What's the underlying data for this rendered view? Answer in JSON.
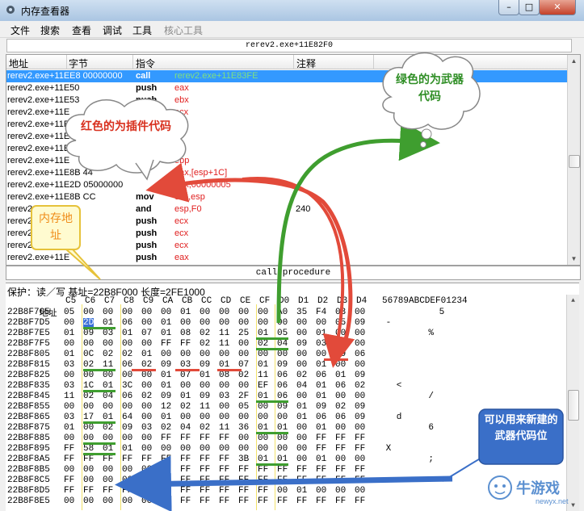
{
  "window": {
    "title": "内存查看器",
    "buttons": {
      "minimize": "–",
      "maximize": "□",
      "close": "✕"
    }
  },
  "menu": [
    "文件",
    "搜索",
    "查看",
    "调试",
    "工具",
    "核心工具"
  ],
  "address_bar": "rerev2.exe+11E82F0",
  "disasm": {
    "columns": [
      "地址",
      "字节",
      "指令",
      "注释"
    ],
    "rows": [
      {
        "addr": "rerev2.exe+11EE8 00000000",
        "op": "call",
        "operand": "rerev2.exe+11E83FE",
        "cmt": "",
        "sel": true
      },
      {
        "addr": "rerev2.exe+11E50",
        "op": "push",
        "operand": "eax",
        "cmt": ""
      },
      {
        "addr": "rerev2.exe+11E53",
        "op": "push",
        "operand": "ebx",
        "cmt": ""
      },
      {
        "addr": "rerev2.exe+11E",
        "op": "",
        "operand": "ecx",
        "cmt": ""
      },
      {
        "addr": "rerev2.exe+11E",
        "op": "",
        "operand": "",
        "cmt": ""
      },
      {
        "addr": "rerev2.exe+11E",
        "op": "",
        "operand": "",
        "cmt": ""
      },
      {
        "addr": "rerev2.exe+11E",
        "op": "",
        "operand": "",
        "cmt": ""
      },
      {
        "addr": "rerev2.exe+11E",
        "op": "",
        "operand": "ebp",
        "cmt": ""
      },
      {
        "addr": "rerev2.exe+11E8B 44",
        "op": "",
        "operand": "eax,[esp+1C]",
        "cmt": ""
      },
      {
        "addr": "rerev2.exe+11E2D 05000000",
        "op": "",
        "operand": "eax,00000005",
        "cmt": ""
      },
      {
        "addr": "rerev2.exe+11E8B CC",
        "op": "mov",
        "operand": "ecx,esp",
        "cmt": ""
      },
      {
        "addr": "rerev2.exe+11E",
        "op": "and",
        "operand": "esp,F0",
        "cmt": "240"
      },
      {
        "addr": "rerev2.exe+11E",
        "op": "push",
        "operand": "ecx",
        "cmt": ""
      },
      {
        "addr": "rerev2.exe+11E",
        "op": "push",
        "operand": "ecx",
        "cmt": ""
      },
      {
        "addr": "rerev2.exe+11E",
        "op": "push",
        "operand": "ecx",
        "cmt": ""
      },
      {
        "addr": "rerev2.exe+11E",
        "op": "push",
        "operand": "eax",
        "cmt": ""
      }
    ]
  },
  "call_bar": "call procedure",
  "hex": {
    "info": "保护：读／写    基址=22B8F000  长度=2FE1000",
    "header": {
      "label": "地址",
      "cols": [
        "C5",
        "C6",
        "C7",
        "C8",
        "C9",
        "CA",
        "CB",
        "CC",
        "CD",
        "CE",
        "CF",
        "D0",
        "D1",
        "D2",
        "D3",
        "D4"
      ],
      "ascii": "56789ABCDEF01234"
    },
    "rows": [
      {
        "addr": "22B8F7C5",
        "bytes": [
          "05",
          "00",
          "00",
          "00",
          "00",
          "00",
          "01",
          "00",
          "00",
          "00",
          "00",
          "A0",
          "35",
          "F4",
          "03",
          "00"
        ],
        "ascii": "           5    "
      },
      {
        "addr": "22B8F7D5",
        "bytes": [
          "00",
          "2D",
          "01",
          "06",
          "00",
          "01",
          "00",
          "00",
          "00",
          "00",
          "00",
          "00",
          "00",
          "00",
          "05",
          "09"
        ],
        "ascii": " -              "
      },
      {
        "addr": "22B8F7E5",
        "bytes": [
          "01",
          "09",
          "03",
          "01",
          "07",
          "01",
          "08",
          "02",
          "11",
          "25",
          "01",
          "05",
          "00",
          "01",
          "00",
          "00"
        ],
        "ascii": "         %      "
      },
      {
        "addr": "22B8F7F5",
        "bytes": [
          "00",
          "00",
          "00",
          "00",
          "00",
          "FF",
          "FF",
          "02",
          "11",
          "00",
          "02",
          "04",
          "09",
          "03",
          "09",
          "00"
        ],
        "ascii": "                "
      },
      {
        "addr": "22B8F805",
        "bytes": [
          "01",
          "0C",
          "02",
          "02",
          "01",
          "00",
          "00",
          "00",
          "00",
          "00",
          "00",
          "00",
          "00",
          "00",
          "09",
          "06"
        ],
        "ascii": "                "
      },
      {
        "addr": "22B8F815",
        "bytes": [
          "03",
          "02",
          "11",
          "06",
          "02",
          "09",
          "03",
          "09",
          "01",
          "07",
          "01",
          "09",
          "00",
          "01",
          "00",
          "00"
        ],
        "ascii": "                "
      },
      {
        "addr": "22B8F825",
        "bytes": [
          "00",
          "00",
          "00",
          "00",
          "00",
          "01",
          "07",
          "01",
          "08",
          "02",
          "11",
          "06",
          "02",
          "06",
          "01",
          "09"
        ],
        "ascii": "                "
      },
      {
        "addr": "22B8F835",
        "bytes": [
          "03",
          "1C",
          "01",
          "3C",
          "00",
          "01",
          "00",
          "00",
          "00",
          "00",
          "EF",
          "06",
          "04",
          "01",
          "06",
          "02"
        ],
        "ascii": "   <            "
      },
      {
        "addr": "22B8F845",
        "bytes": [
          "11",
          "02",
          "04",
          "06",
          "02",
          "09",
          "01",
          "09",
          "03",
          "2F",
          "01",
          "06",
          "00",
          "01",
          "00",
          "00"
        ],
        "ascii": "         /      "
      },
      {
        "addr": "22B8F855",
        "bytes": [
          "00",
          "00",
          "00",
          "00",
          "00",
          "12",
          "02",
          "11",
          "00",
          "05",
          "00",
          "09",
          "01",
          "09",
          "02",
          "09"
        ],
        "ascii": "                "
      },
      {
        "addr": "22B8F865",
        "bytes": [
          "03",
          "17",
          "01",
          "64",
          "00",
          "01",
          "00",
          "00",
          "00",
          "00",
          "00",
          "00",
          "01",
          "06",
          "06",
          "09"
        ],
        "ascii": "   d            "
      },
      {
        "addr": "22B8F875",
        "bytes": [
          "01",
          "00",
          "02",
          "09",
          "03",
          "02",
          "04",
          "02",
          "11",
          "36",
          "01",
          "01",
          "00",
          "01",
          "00",
          "00"
        ],
        "ascii": "         6      "
      },
      {
        "addr": "22B8F885",
        "bytes": [
          "00",
          "00",
          "00",
          "00",
          "00",
          "FF",
          "FF",
          "FF",
          "FF",
          "00",
          "00",
          "00",
          "00",
          "FF",
          "FF",
          "FF"
        ],
        "ascii": "                "
      },
      {
        "addr": "22B8F895",
        "bytes": [
          "FF",
          "58",
          "01",
          "01",
          "00",
          "00",
          "00",
          "00",
          "00",
          "00",
          "00",
          "00",
          "00",
          "FF",
          "FF",
          "FF"
        ],
        "ascii": " X              "
      },
      {
        "addr": "22B8F8A5",
        "bytes": [
          "FF",
          "FF",
          "FF",
          "FF",
          "FF",
          "FF",
          "FF",
          "FF",
          "FF",
          "3B",
          "01",
          "01",
          "00",
          "01",
          "00",
          "00"
        ],
        "ascii": "         ;      "
      },
      {
        "addr": "22B8F8B5",
        "bytes": [
          "00",
          "00",
          "00",
          "00",
          "00",
          "FF",
          "FF",
          "FF",
          "FF",
          "FF",
          "FF",
          "FF",
          "FF",
          "FF",
          "FF",
          "FF"
        ],
        "ascii": "                "
      },
      {
        "addr": "22B8F8C5",
        "bytes": [
          "FF",
          "00",
          "00",
          "00",
          "00",
          "FF",
          "FF",
          "FF",
          "FF",
          "FF",
          "FF",
          "FF",
          "FF",
          "FF",
          "FF",
          "FF"
        ],
        "ascii": "                "
      },
      {
        "addr": "22B8F8D5",
        "bytes": [
          "FF",
          "FF",
          "FF",
          "FF",
          "FF",
          "FF",
          "FF",
          "FF",
          "FF",
          "FF",
          "FF",
          "00",
          "01",
          "00",
          "00",
          "00"
        ],
        "ascii": "                "
      },
      {
        "addr": "22B8F8E5",
        "bytes": [
          "00",
          "00",
          "00",
          "00",
          "00",
          "FF",
          "FF",
          "FF",
          "FF",
          "FF",
          "FF",
          "FF",
          "FF",
          "FF",
          "FF",
          "FF"
        ],
        "ascii": "                "
      }
    ]
  },
  "annotations": {
    "red_cloud": "红色的为插件代码",
    "green_cloud": "绿色的为武器代码",
    "yellow_note": "内存地址",
    "blue_note": "可以用来新建的武器代码位",
    "colors": {
      "red": "#e24a3a",
      "green": "#3f9e2f",
      "yellow": "#f2e26a",
      "blue": "#3a6fc8",
      "selection": "#3399ff"
    }
  },
  "watermark": {
    "logo": "牛游戏",
    "url": "newyx.net"
  }
}
